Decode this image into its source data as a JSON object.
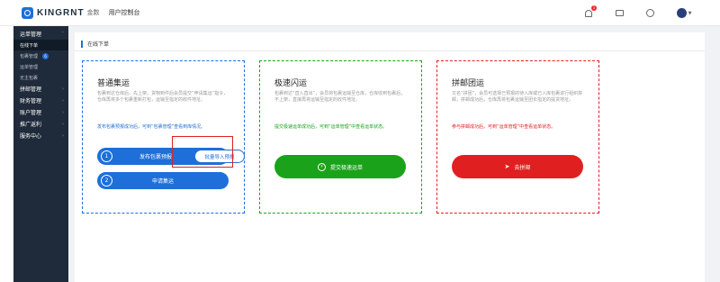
{
  "header": {
    "logo_text": "KINGRNT",
    "logo_cn": "金数",
    "console_title": "用户控制台",
    "notification_count": "1"
  },
  "sidebar": {
    "groups": [
      {
        "label": "运单管理",
        "items": [
          {
            "label": "在线下单",
            "active": true
          },
          {
            "label": "包裹管理",
            "badge": "6"
          },
          {
            "label": "运单管理"
          },
          {
            "label": "无主包裹"
          }
        ]
      },
      {
        "label": "拼邮管理"
      },
      {
        "label": "财务管理"
      },
      {
        "label": "账户管理"
      },
      {
        "label": "推广返利"
      },
      {
        "label": "服务中心"
      }
    ]
  },
  "breadcrumb": {
    "title": "在线下单"
  },
  "cards": {
    "standard": {
      "title": "普通集运",
      "description": "包裹到达仓库后，先上架。货物到件后会员提交“申请集运”指令，仓库再将多个包裹重新打包，运输至指定的收件地址。",
      "note": "发布包裹预报成功后，可到“包裹管理”查看到库情况。",
      "step1_number": "1",
      "step1_label": "发布包裹预报",
      "import_label": "批量导入预报",
      "step2_number": "2",
      "step2_label": "申请集运"
    },
    "express": {
      "title": "极速闪运",
      "description": "包裹到达“直入直出”，会员将包裹运输至仓库，仓库收到包裹后，不上架，直接再将运输至指定的收件地址。",
      "note": "提交极速运单成功后，可到“运单管理”中查看运单状态。",
      "button_label": "提交极速运单"
    },
    "group": {
      "title": "拼邮团运",
      "description": "又名“拼团”，会员可选择已预报的待入库或已入库包裹进行组织拼邮，拼邮成功后，仓库再将包裹运输至团长指定的提货地址。",
      "note": "参与拼邮成功后，可到“运单管理”中查看运单状态。",
      "button_label": "去拼邮"
    }
  },
  "colors": {
    "blue": "#1e6fd9",
    "green": "#1aa31a",
    "red": "#e02020"
  }
}
